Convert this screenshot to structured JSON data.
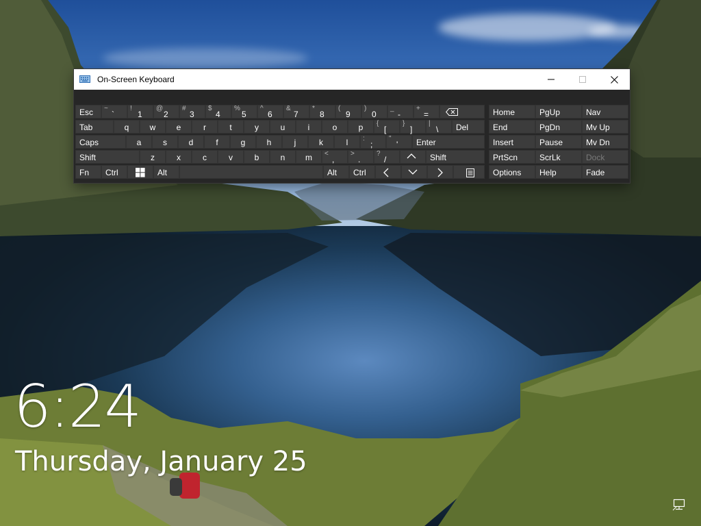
{
  "window": {
    "title": "On-Screen Keyboard",
    "icon": "keyboard-icon",
    "controls": {
      "minimize": "–",
      "maximize": "□",
      "close": "✕"
    }
  },
  "keyboard": {
    "row1": [
      {
        "id": "esc",
        "label": "Esc"
      },
      {
        "id": "tilde",
        "primary": "`",
        "secondary": "~"
      },
      {
        "id": "1",
        "primary": "1",
        "secondary": "!"
      },
      {
        "id": "2",
        "primary": "2",
        "secondary": "@"
      },
      {
        "id": "3",
        "primary": "3",
        "secondary": "#"
      },
      {
        "id": "4",
        "primary": "4",
        "secondary": "$"
      },
      {
        "id": "5",
        "primary": "5",
        "secondary": "%"
      },
      {
        "id": "6",
        "primary": "6",
        "secondary": "^"
      },
      {
        "id": "7",
        "primary": "7",
        "secondary": "&"
      },
      {
        "id": "8",
        "primary": "8",
        "secondary": "*"
      },
      {
        "id": "9",
        "primary": "9",
        "secondary": "("
      },
      {
        "id": "0",
        "primary": "0",
        "secondary": ")"
      },
      {
        "id": "minus",
        "primary": "-",
        "secondary": "_"
      },
      {
        "id": "equals",
        "primary": "=",
        "secondary": "+"
      },
      {
        "id": "backspace",
        "icon": "backspace-icon"
      }
    ],
    "row2": [
      {
        "id": "tab",
        "label": "Tab"
      },
      {
        "id": "q",
        "label": "q"
      },
      {
        "id": "w",
        "label": "w"
      },
      {
        "id": "e",
        "label": "e"
      },
      {
        "id": "r",
        "label": "r"
      },
      {
        "id": "t",
        "label": "t"
      },
      {
        "id": "y",
        "label": "y"
      },
      {
        "id": "u",
        "label": "u"
      },
      {
        "id": "i",
        "label": "i"
      },
      {
        "id": "o",
        "label": "o"
      },
      {
        "id": "p",
        "label": "p"
      },
      {
        "id": "lbracket",
        "primary": "[",
        "secondary": "{"
      },
      {
        "id": "rbracket",
        "primary": "]",
        "secondary": "}"
      },
      {
        "id": "backslash",
        "primary": "\\",
        "secondary": "|"
      },
      {
        "id": "del",
        "label": "Del"
      }
    ],
    "row3": [
      {
        "id": "caps",
        "label": "Caps"
      },
      {
        "id": "a",
        "label": "a"
      },
      {
        "id": "s",
        "label": "s"
      },
      {
        "id": "d",
        "label": "d"
      },
      {
        "id": "f",
        "label": "f"
      },
      {
        "id": "g",
        "label": "g"
      },
      {
        "id": "h",
        "label": "h"
      },
      {
        "id": "j",
        "label": "j"
      },
      {
        "id": "k",
        "label": "k"
      },
      {
        "id": "l",
        "label": "l"
      },
      {
        "id": "semicolon",
        "primary": ";",
        "secondary": ":"
      },
      {
        "id": "quote",
        "primary": "'",
        "secondary": "\""
      },
      {
        "id": "enter",
        "label": "Enter"
      }
    ],
    "row4": [
      {
        "id": "shift-left",
        "label": "Shift"
      },
      {
        "id": "z",
        "label": "z"
      },
      {
        "id": "x",
        "label": "x"
      },
      {
        "id": "c",
        "label": "c"
      },
      {
        "id": "v",
        "label": "v"
      },
      {
        "id": "b",
        "label": "b"
      },
      {
        "id": "n",
        "label": "n"
      },
      {
        "id": "m",
        "label": "m"
      },
      {
        "id": "comma",
        "primary": ",",
        "secondary": "<"
      },
      {
        "id": "period",
        "primary": ".",
        "secondary": ">"
      },
      {
        "id": "slash",
        "primary": "/",
        "secondary": "?"
      },
      {
        "id": "up",
        "icon": "chevron-up-icon"
      },
      {
        "id": "shift-right",
        "label": "Shift"
      }
    ],
    "row5": [
      {
        "id": "fn",
        "label": "Fn"
      },
      {
        "id": "ctrl-left",
        "label": "Ctrl"
      },
      {
        "id": "win",
        "icon": "windows-logo-icon"
      },
      {
        "id": "alt-left",
        "label": "Alt"
      },
      {
        "id": "space",
        "label": ""
      },
      {
        "id": "alt-right",
        "label": "Alt"
      },
      {
        "id": "ctrl-right",
        "label": "Ctrl"
      },
      {
        "id": "left",
        "icon": "chevron-left-icon"
      },
      {
        "id": "down",
        "icon": "chevron-down-icon"
      },
      {
        "id": "right",
        "icon": "chevron-right-icon"
      },
      {
        "id": "menu",
        "icon": "menu-key-icon"
      }
    ],
    "nav": {
      "home": "Home",
      "pgup": "PgUp",
      "nav": "Nav",
      "end": "End",
      "pgdn": "PgDn",
      "mvup": "Mv Up",
      "insert": "Insert",
      "pause": "Pause",
      "mvdn": "Mv Dn",
      "prtscn": "PrtScn",
      "scrlk": "ScrLk",
      "dock": "Dock",
      "options": "Options",
      "help": "Help",
      "fade": "Fade"
    }
  },
  "lockscreen": {
    "time": "6:24",
    "date": "Thursday, January 25",
    "network_icon": "network-icon"
  },
  "colors": {
    "key_bg": "#3c3c3c",
    "keyboard_bg": "#262626",
    "titlebar_bg": "#ffffff",
    "disabled_text": "#7a7a7a"
  }
}
